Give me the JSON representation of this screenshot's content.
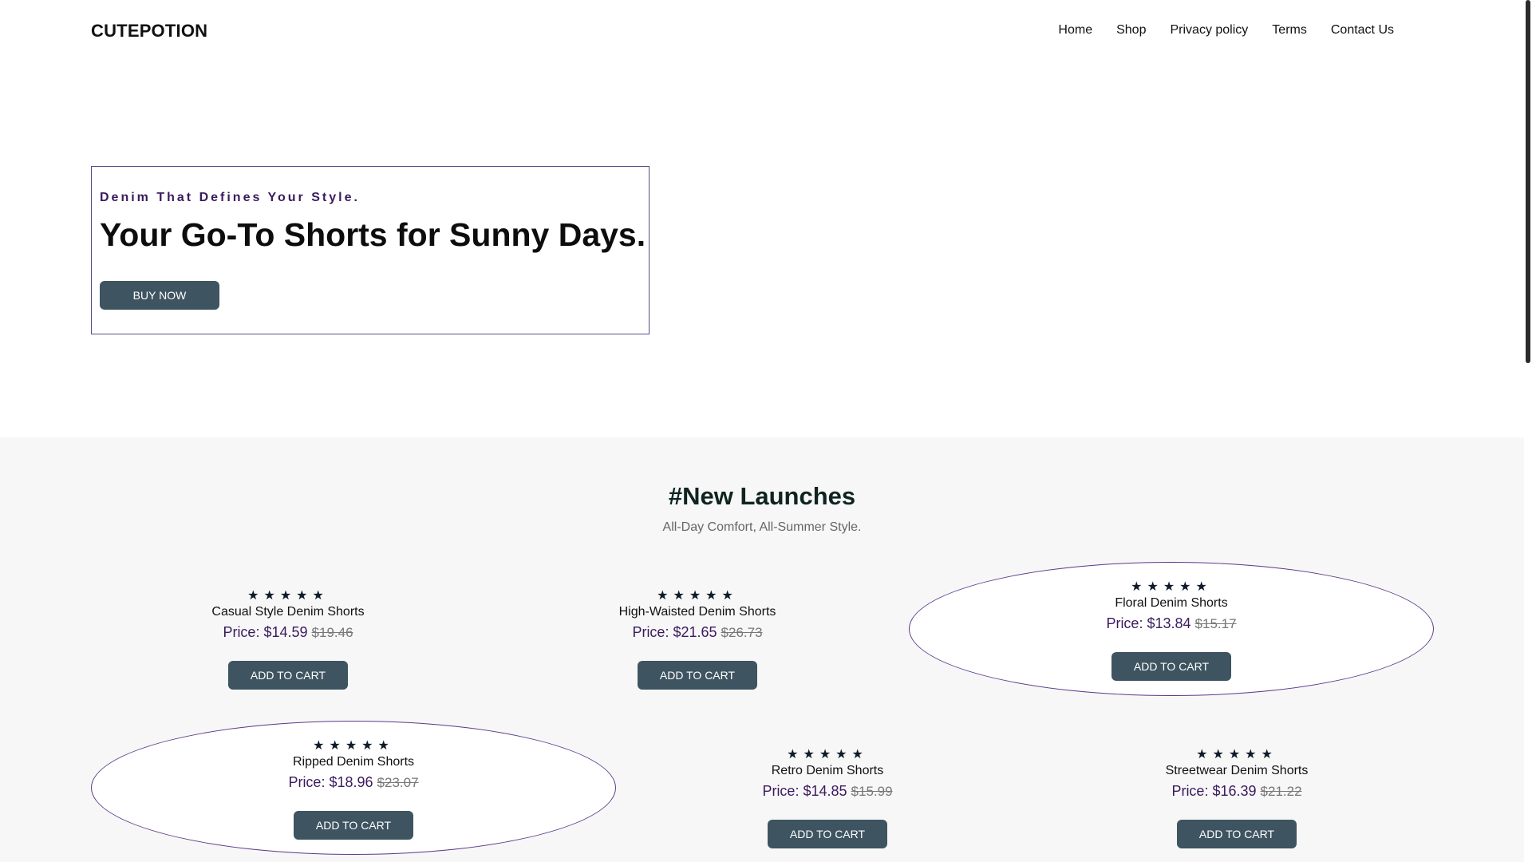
{
  "header": {
    "logo": "CUTEPOTION",
    "nav": [
      "Home",
      "Shop",
      "Privacy policy",
      "Terms",
      "Contact Us"
    ]
  },
  "hero": {
    "kicker": "Denim That Defines Your Style.",
    "title": "Your Go-To Shorts for Sunny Days.",
    "button": "BUY NOW"
  },
  "launches": {
    "title": "#New Launches",
    "subtitle": "All-Day Comfort, All-Summer Style.",
    "stars": "★★★★★",
    "price_label": "Price:",
    "button": "ADD TO CART",
    "products": [
      {
        "name": "Casual Style Denim Shorts",
        "price": "$14.59",
        "old_price": "$19.46"
      },
      {
        "name": "High-Waisted Denim Shorts",
        "price": "$21.65",
        "old_price": "$26.73"
      },
      {
        "name": "Floral Denim Shorts",
        "price": "$13.84",
        "old_price": "$15.17"
      },
      {
        "name": "Ripped Denim Shorts",
        "price": "$18.96",
        "old_price": "$23.07"
      },
      {
        "name": "Retro Denim Shorts",
        "price": "$14.85",
        "old_price": "$15.99"
      },
      {
        "name": "Streetwear Denim Shorts",
        "price": "$16.39",
        "old_price": "$21.22"
      }
    ]
  },
  "colors": {
    "button_bg": "#3e5460",
    "accent_purple": "#3a1a5e",
    "outline": "#5a3a8a"
  }
}
